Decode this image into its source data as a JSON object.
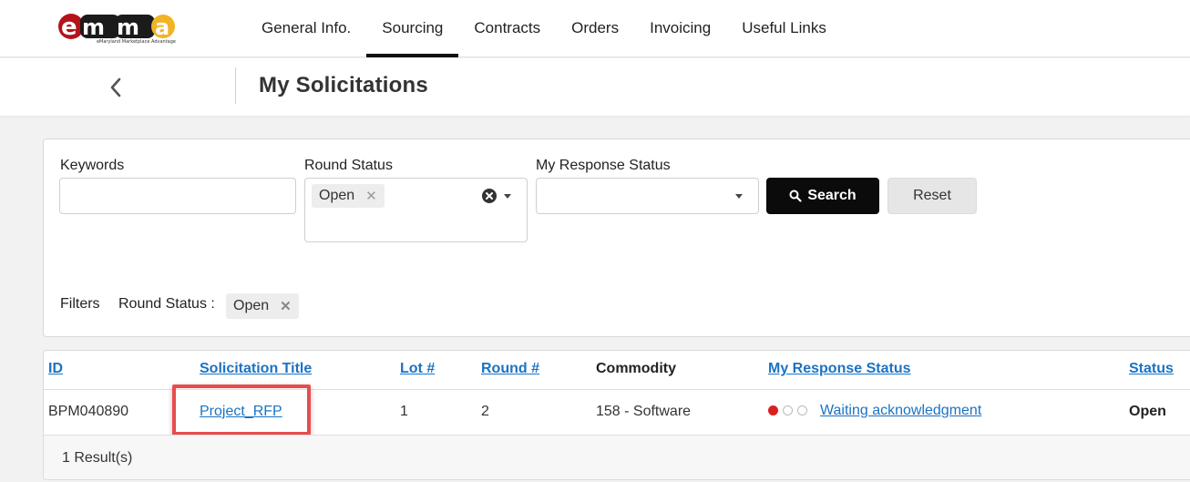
{
  "brand": {
    "logo_text": "emma",
    "tagline": "eMaryland Marketplace Advantage"
  },
  "nav": {
    "tabs": [
      {
        "label": "General Info."
      },
      {
        "label": "Sourcing",
        "active": true
      },
      {
        "label": "Contracts"
      },
      {
        "label": "Orders"
      },
      {
        "label": "Invoicing"
      },
      {
        "label": "Useful Links"
      }
    ]
  },
  "header": {
    "title": "My Solicitations"
  },
  "filters": {
    "keywords_label": "Keywords",
    "keywords_value": "",
    "round_status_label": "Round Status",
    "round_status_chip": "Open",
    "response_status_label": "My Response Status",
    "response_status_value": "",
    "search_label": "Search",
    "reset_label": "Reset",
    "active_filters_label": "Filters",
    "active_filter_name": "Round Status :",
    "active_filter_value": "Open"
  },
  "table": {
    "columns": {
      "id": "ID",
      "title": "Solicitation Title",
      "lot": "Lot #",
      "round": "Round #",
      "commodity": "Commodity",
      "response_status": "My Response Status",
      "status": "Status"
    },
    "rows": [
      {
        "id": "BPM040890",
        "title": "Project_RFP",
        "lot": "1",
        "round": "2",
        "commodity": "158 - Software",
        "response_status": "Waiting acknowledgment",
        "status": "Open"
      }
    ],
    "results_count": "1 Result(s)"
  },
  "colors": {
    "accent": "#1a73c4",
    "primary_button": "#0b0b0b",
    "highlight": "#e84c4c",
    "status_dot_active": "#d92020"
  }
}
